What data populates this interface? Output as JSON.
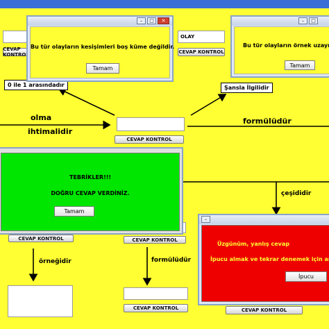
{
  "window": {
    "ok_label": "Tamam"
  },
  "dialogs": {
    "top_left": {
      "message": "Bu tür olayların kesişimleri boş küme değildir.",
      "button": "Tamam"
    },
    "top_right": {
      "message": "Bu tür olayların örnek uzayı",
      "button": "Tamam"
    },
    "success": {
      "line1": "TEBRİKLER!!!",
      "line2": "DOĞRU CEVAP VERDİNİZ.",
      "button": "Tamam"
    },
    "error": {
      "line1": "Üzgünüm, yanlış cevap",
      "line2": "İpucu almak ve tekrar denemek için aşağı",
      "button": "İpucu"
    }
  },
  "labels": {
    "olay": "OLAY",
    "range": "0 ile 1 arasındadır",
    "chance": "Şansla İlgilidir",
    "olma": "olma",
    "ihtimalidir": "ihtimalidir",
    "formuludur_right": "formülüdür",
    "cesididir": "çeşididir",
    "ornegidir": "örneğidir",
    "formuludur_bottom": "formülüdür"
  },
  "buttons": {
    "check": "CEVAP KONTROL"
  },
  "colors": {
    "background": "#ffff33",
    "success": "#00e600",
    "error": "#ee0000",
    "dialog_body": "#ffff33"
  }
}
